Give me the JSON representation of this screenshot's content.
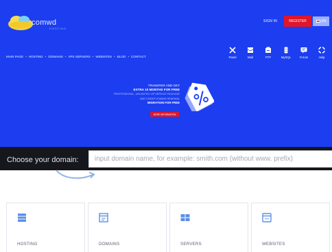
{
  "header": {
    "logo_text": "comwd",
    "logo_subtext": "HOSTING",
    "sign_in": "SIGN IN",
    "register": "REGISTER",
    "language": "EN"
  },
  "nav": {
    "items": [
      "MAIN PAGE",
      "HOSTING",
      "DOMAINS",
      "VPS SERVERS",
      "WEBSITES",
      "BLOG",
      "CONTACT"
    ],
    "separator": "•"
  },
  "quick_links": [
    {
      "label": "Panel",
      "icon": "tools-icon"
    },
    {
      "label": "Mail",
      "icon": "mail-icon"
    },
    {
      "label": "FTP",
      "icon": "ftp-icon"
    },
    {
      "label": "MySQL",
      "icon": "database-icon"
    },
    {
      "label": "Forum",
      "icon": "forum-icon"
    },
    {
      "label": "Help",
      "icon": "help-icon"
    }
  ],
  "promo": {
    "line1": "TRANSFER AND GET",
    "line2": "EXTRA 10 MONTHS FOR FREE",
    "desc1": "PROFESSIONAL, UNLIMITED VIP SERVICE PACKAGE",
    "desc2": "AND CHEAP DOMAIN RENEWAL",
    "line3": "MIGRATION FOR FREE",
    "button": "MORE INFORMATION"
  },
  "domain_search": {
    "label": "Choose your domain:",
    "placeholder": "input domain name, for example: smith.com (without www. prefix)"
  },
  "cards": [
    {
      "label": "HOSTING",
      "icon": "server-icon"
    },
    {
      "label": "DOMAINS",
      "icon": "domain-icon"
    },
    {
      "label": "SERVERS",
      "icon": "servers-icon"
    },
    {
      "label": "WEBSITES",
      "icon": "website-icon"
    }
  ],
  "colors": {
    "hero_bg": "#1c3ef0",
    "accent_red": "#e0162b",
    "search_bar_bg": "#16171c",
    "card_icon": "#5a8fe8"
  }
}
